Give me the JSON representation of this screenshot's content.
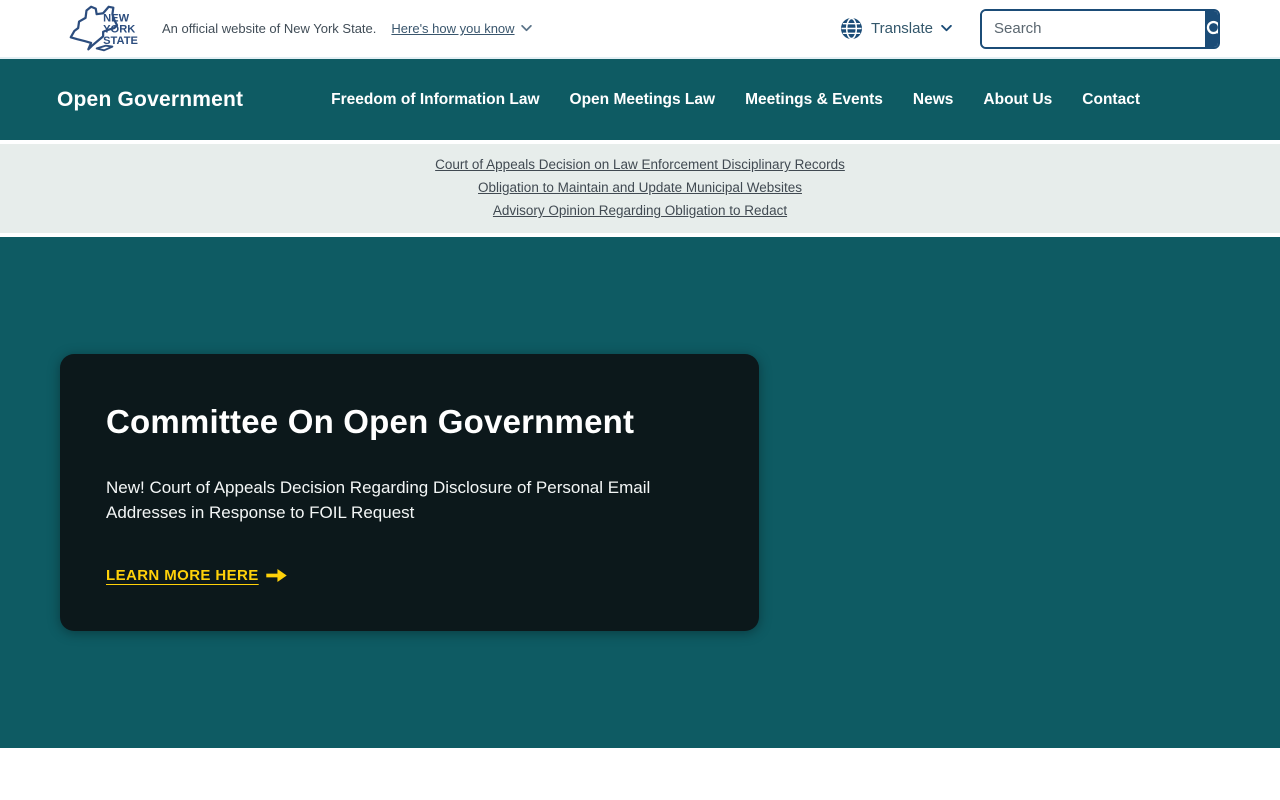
{
  "topbar": {
    "logo_lines": [
      "NEW",
      "YORK",
      "STATE"
    ],
    "official_text": "An official website of New York State.",
    "how_you_know_label": "Here's how you know",
    "translate_label": "Translate",
    "search_placeholder": "Search"
  },
  "nav": {
    "site_title": "Open Government",
    "items": [
      "Freedom of Information Law",
      "Open Meetings Law",
      "Meetings & Events",
      "News",
      "About Us",
      "Contact"
    ]
  },
  "banner": {
    "links": [
      "Court of Appeals Decision on Law Enforcement Disciplinary Records",
      "Obligation to Maintain and Update Municipal Websites",
      "Advisory Opinion Regarding Obligation to Redact"
    ]
  },
  "hero": {
    "card": {
      "title": "Committee On Open Government",
      "body": "New! Court of Appeals Decision Regarding Disclosure of Personal Email Addresses in Response to FOIL Request",
      "cta_label": "LEARN MORE HERE"
    }
  },
  "colors": {
    "teal": "#0e5b63",
    "navy": "#1b4c77",
    "card_bg": "#0c181b",
    "banner_bg": "#e7edeb",
    "cta_yellow": "#ffd109"
  }
}
